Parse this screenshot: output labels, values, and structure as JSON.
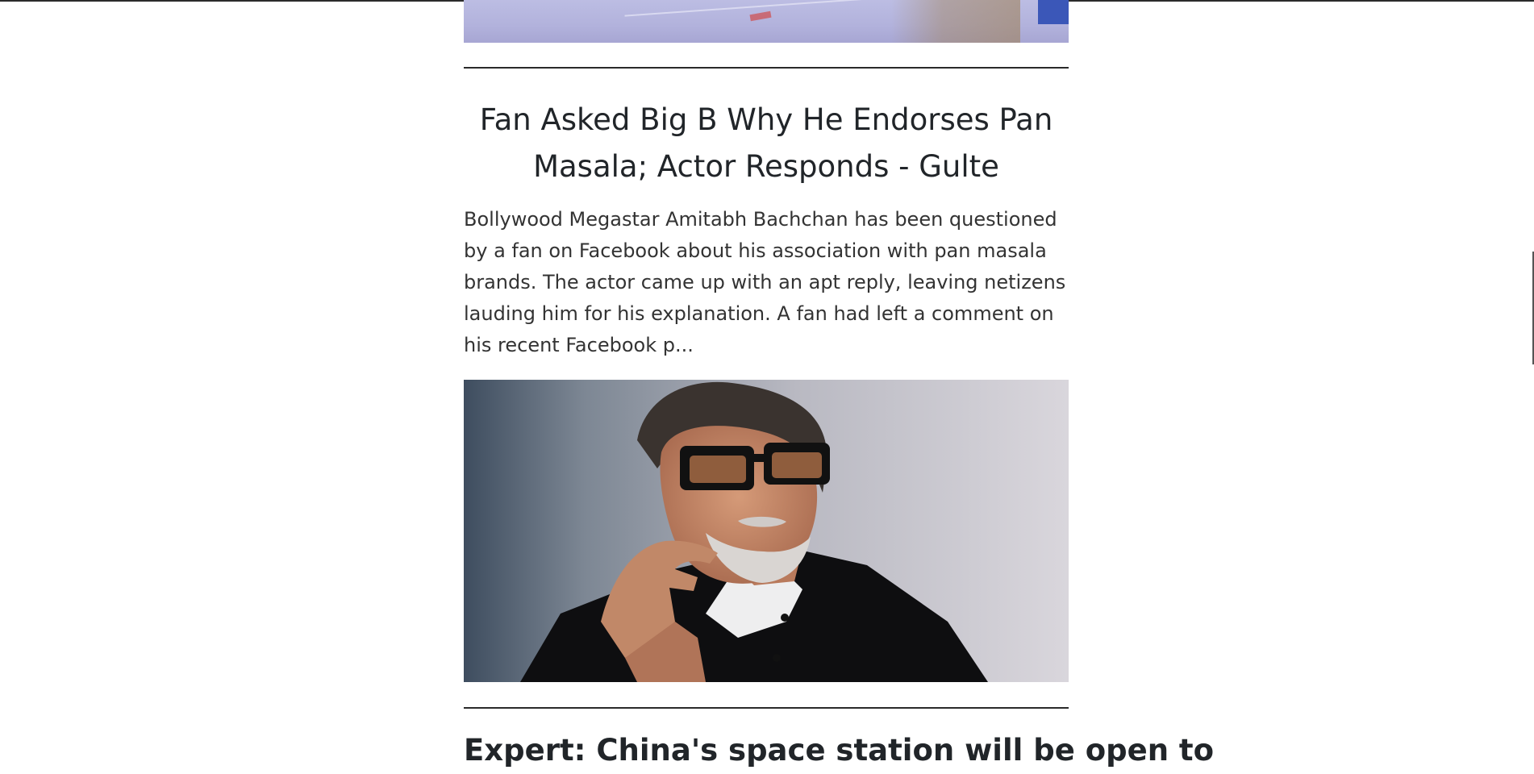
{
  "article": {
    "headline": "Fan Asked Big B Why He Endorses Pan Masala; Actor Responds - Gulte",
    "summary": "Bollywood Megastar Amitabh Bachchan has been questioned by a fan on Facebook about his association with pan masala brands. The actor came up with an apt reply, leaving netizens lauding him for his explanation. A fan had left a comment on his recent Facebook p...",
    "image_subject": "Amitabh Bachchan in dark glasses and black suit"
  },
  "next_article": {
    "headline": "Expert: China's space station will be open to"
  },
  "colors": {
    "text": "#212529",
    "divider": "#2a2a2a",
    "background": "#ffffff"
  }
}
